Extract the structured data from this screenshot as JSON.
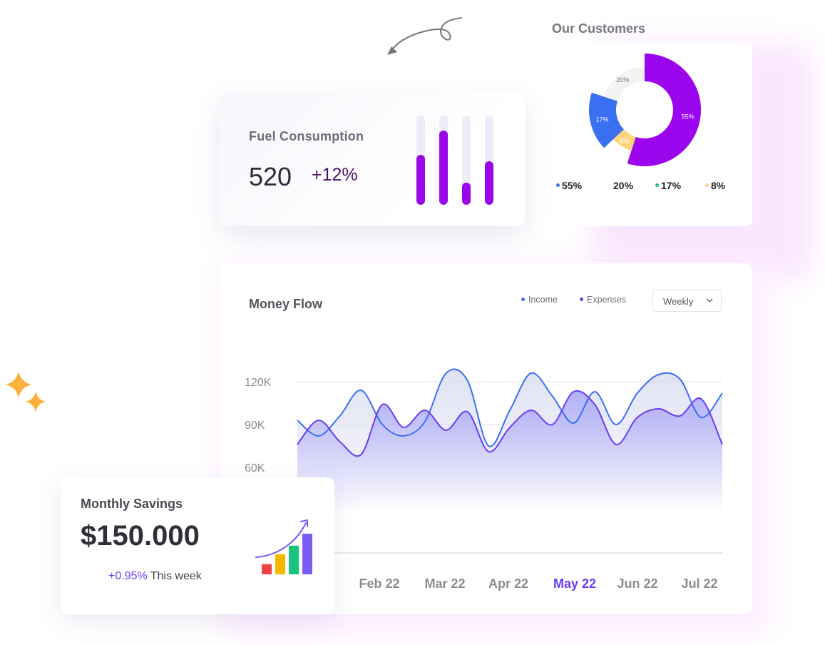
{
  "fuel": {
    "title": "Fuel Consumption",
    "value": "520",
    "change": "+12%",
    "bar_levels": [
      0.56,
      0.83,
      0.25,
      0.49
    ]
  },
  "customers": {
    "title": "Our Customers",
    "slices": [
      {
        "label": "55%",
        "value": 55,
        "color": "#9b05ee"
      },
      {
        "label": "8%",
        "value": 8,
        "color": "#fcd57a"
      },
      {
        "label": "17%",
        "value": 17,
        "color": "#3a6ff2"
      },
      {
        "label": "20%",
        "value": 20,
        "color": "#f3f3f6"
      }
    ],
    "legend": [
      {
        "label": "55%",
        "color": "#3a6ff2"
      },
      {
        "label": "20%",
        "color": ""
      },
      {
        "label": "17%",
        "color": "#19c37d"
      },
      {
        "label": "8%",
        "color": "#fcd57a"
      }
    ]
  },
  "money_flow": {
    "title": "Money Flow",
    "legend_income": "Income",
    "legend_expenses": "Expenses",
    "income_color": "#3a6ff2",
    "expenses_color": "#6b3df0",
    "period_select": "Weekly",
    "active_month": "May 22",
    "active_color": "#6b3df0"
  },
  "chart_data": {
    "type": "line",
    "x": [
      0,
      0.5,
      1,
      1.5,
      2,
      2.5,
      3,
      3.5,
      4,
      4.5,
      5,
      5.5,
      6,
      6.5,
      7,
      7.5,
      8,
      8.5,
      9,
      9.5,
      10
    ],
    "x_tick_labels": [
      "Feb 22",
      "Mar 22",
      "Apr 22",
      "May 22",
      "Jun 22",
      "Jul 22"
    ],
    "yticks": [
      "120K",
      "90K",
      "60K"
    ],
    "ylim": [
      30000,
      130000
    ],
    "series": [
      {
        "name": "Income",
        "values": [
          93000,
          82000,
          96000,
          114000,
          90000,
          82000,
          92000,
          126000,
          121000,
          75000,
          100000,
          126000,
          110000,
          91000,
          113000,
          90000,
          112000,
          125000,
          122000,
          95000,
          112000
        ]
      },
      {
        "name": "Expenses",
        "values": [
          76000,
          93000,
          78000,
          69000,
          104000,
          88000,
          100000,
          86000,
          99000,
          71000,
          88000,
          100000,
          90000,
          113000,
          104000,
          76000,
          95000,
          101000,
          96000,
          108000,
          76000
        ]
      }
    ],
    "grid": true
  },
  "savings": {
    "title": "Monthly Savings",
    "value": "$150.000",
    "change": "+0.95%",
    "period": "This week",
    "bar_levels": [
      0.24,
      0.47,
      0.67,
      0.95
    ],
    "bar_colors": [
      "#ef4444",
      "#f5b800",
      "#19c37d",
      "#7b5cf5"
    ]
  }
}
